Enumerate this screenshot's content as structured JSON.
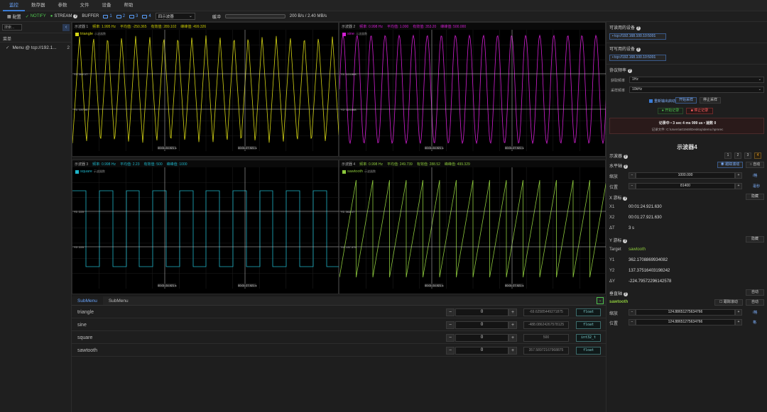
{
  "menubar": {
    "items": [
      "监控",
      "数存器",
      "参数",
      "文件",
      "设备",
      "帮助"
    ]
  },
  "toolbar": {
    "layout_label": "配置",
    "notify_label": "NOTIFY",
    "stream_label": "STREAM",
    "buffer_label": "BUFFER",
    "ch1": "1",
    "ch2": "2",
    "ch3": "3",
    "ch4": "4",
    "scope_mode": "四示波器",
    "buffer_title": "缓冲",
    "throughput": "200 B/s / 2.40 MB/s"
  },
  "left": {
    "search": "搜索...",
    "section": "菜单",
    "item": "Menu @ tcp://192.1...",
    "item_count": "2"
  },
  "scopes": [
    {
      "title": "示波器 1",
      "freq": "频率: 1.995 Hz",
      "avg": "平均值: -250.365",
      "rms": "有效值: 289.102",
      "pp": "峰峰值: 499.326",
      "tag": "triangle",
      "tag_sub": "示波器数",
      "color": "#d4d414",
      "cursor1": "Y1: 137.36",
      "cursor2": "Y2: 362.17",
      "xlabel1": "00:01:24.921 s",
      "xlabel2": "00:01:27.921 s"
    },
    {
      "title": "示波器 2",
      "freq": "频率: 0.998 Hz",
      "avg": "平均值: 1.000",
      "rms": "有效值: 353.20",
      "pp": "峰峰值: 500.000",
      "tag": "sine",
      "tag_sub": "示波器数",
      "color": "#d21ed2",
      "cursor1": "Y1: 124.888",
      "cursor2": "Y2: 124.888",
      "xlabel1": "00:01:24.921 s",
      "xlabel2": "00:01:27.921 s"
    },
    {
      "title": "示波器 3",
      "freq": "频率: 0.998 Hz",
      "avg": "平均值: 2.23",
      "rms": "有效值: 500",
      "pp": "峰峰值: 1000",
      "tag": "square",
      "tag_sub": "示波器数",
      "color": "#1eb4c8",
      "cursor1": "Y1: 225",
      "cursor2": "Y2: 225",
      "xlabel1": "00:01:24.921 s",
      "xlabel2": "00:01:27.921 s"
    },
    {
      "title": "示波器 4",
      "freq": "频率: 0.998 Hz",
      "avg": "平均值: 249.739",
      "rms": "有效值: 288.52",
      "pp": "峰峰值: 499.329",
      "tag": "sawtooth",
      "tag_sub": "示波器数",
      "color": "#8cc83c",
      "cursor1": "Y1: 362.17",
      "cursor2": "Y2: 137.375",
      "xlabel1": "00:01:24.921 s",
      "xlabel2": "00:01:27.921 s"
    }
  ],
  "submenu": {
    "tabs": [
      "SubMenu",
      "SubMenu"
    ],
    "rows": [
      {
        "name": "triangle",
        "value": "0",
        "raw": "-69.62585449271875",
        "type": "float"
      },
      {
        "name": "sine",
        "value": "0",
        "raw": "-488.08624267578125",
        "type": "float"
      },
      {
        "name": "square",
        "value": "0",
        "raw": "500",
        "type": "int32_t"
      },
      {
        "name": "sawtooth",
        "value": "0",
        "raw": "357.58972167968875",
        "type": "float"
      }
    ]
  },
  "right": {
    "read_devices": "可读用的设备",
    "read_device_addr": "tcp://192.168.100.10:5001",
    "write_devices": "可写用的设备",
    "write_device_addr": "tcp://192.168.100.10:5001",
    "protocol": "协议频率",
    "collect_label": "获取频率",
    "collect_value": "1Hz",
    "sample_label": "采样频率",
    "sample_value": "10kHz",
    "auto_start": "重新输出启动",
    "start_btn": "开始采样",
    "stop_btn": "停止采样",
    "start_record": "开始记录",
    "stop_record": "停止记录",
    "record_status": "记录中 • 3 sec 4 ms 999 us • 速数 0",
    "record_file": "记录文件: C:\\Users\\a01948\\Desktop\\demo.hpmrec",
    "scope_title": "示波器4",
    "scope_label": "示波器",
    "scope_tabs": [
      "1",
      "2",
      "3",
      "4"
    ],
    "horizontal": "水平轴",
    "follow": "跟踪滚动",
    "auto": "自动",
    "scale_label": "缩放",
    "scale_value": "1000.000",
    "scale_unit": "/格",
    "pos_label": "位置",
    "pos_value": "81400",
    "pos_unit": "毫秒",
    "x_cursor": "X 游标",
    "hide": "隐藏",
    "x1_label": "X1",
    "x1_value": "00:01:24.921.630",
    "x2_label": "X2",
    "x2_value": "00:01:27.921.630",
    "dx_label": "ΔT",
    "dx_value": "3 s",
    "y_cursor": "Y 游标",
    "target_label": "Target",
    "target_value": "sawtooth",
    "y1_label": "Y1",
    "y1_value": "362.1708869934082",
    "y2_label": "Y2",
    "y2_value": "137.37516403198242",
    "dy_label": "ΔY",
    "dy_value": "-224.79572296142578",
    "vertical": "垂直轴",
    "auto2": "自动",
    "ch_name": "sawtooth",
    "follow2": "跟踪滚动",
    "auto3": "自动",
    "vscale_label": "缩放",
    "vscale_value": "124.88651275634766",
    "vscale_unit": "/格",
    "vpos_label": "位置",
    "vpos_value": "124.88651275634766",
    "vpos_unit": "格"
  }
}
